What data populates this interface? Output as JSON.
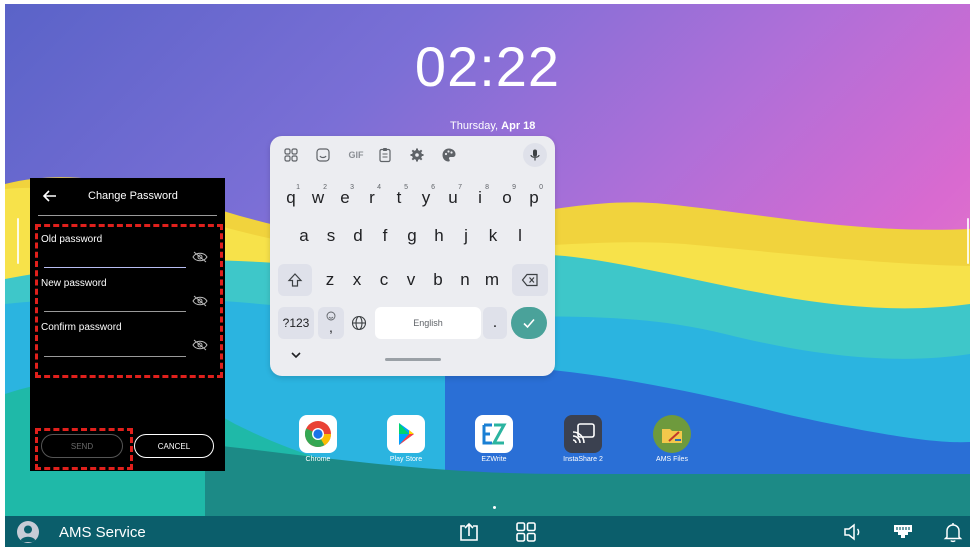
{
  "home": {
    "clock": "02:22",
    "date_weekday": "Thursday,",
    "date_day": "Apr 18"
  },
  "change_password": {
    "title": "Change Password",
    "fields": [
      {
        "label": "Old password",
        "value": ""
      },
      {
        "label": "New password",
        "value": ""
      },
      {
        "label": "Confirm password",
        "value": ""
      }
    ],
    "send_label": "SEND",
    "cancel_label": "CANCEL"
  },
  "keyboard": {
    "toolbar_icons": [
      "apps-grid-icon",
      "sticker-icon",
      "gif-icon",
      "clipboard-icon",
      "settings-icon",
      "theme-palette-icon",
      "microphone-icon"
    ],
    "gif_label": "GIF",
    "row1": [
      {
        "key": "q",
        "hint": "1"
      },
      {
        "key": "w",
        "hint": "2"
      },
      {
        "key": "e",
        "hint": "3"
      },
      {
        "key": "r",
        "hint": "4"
      },
      {
        "key": "t",
        "hint": "5"
      },
      {
        "key": "y",
        "hint": "6"
      },
      {
        "key": "u",
        "hint": "7"
      },
      {
        "key": "i",
        "hint": "8"
      },
      {
        "key": "o",
        "hint": "9"
      },
      {
        "key": "p",
        "hint": "0"
      }
    ],
    "row2": [
      "a",
      "s",
      "d",
      "f",
      "g",
      "h",
      "j",
      "k",
      "l"
    ],
    "row3": [
      "z",
      "x",
      "c",
      "v",
      "b",
      "n",
      "m"
    ],
    "symbols_label": "?123",
    "comma_label": ",",
    "space_label": "English",
    "period_label": "."
  },
  "apps": [
    {
      "label": "Chrome",
      "icon": "chrome-icon"
    },
    {
      "label": "Play Store",
      "icon": "play-store-icon"
    },
    {
      "label": "EZWrite",
      "icon": "ezwrite-icon"
    },
    {
      "label": "InstaShare 2",
      "icon": "instashare-icon"
    },
    {
      "label": "AMS Files",
      "icon": "ams-files-icon"
    }
  ],
  "taskbar": {
    "user_name": "AMS Service",
    "icons": [
      "avatar-icon",
      "share-screen-icon",
      "app-drawer-icon",
      "volume-icon",
      "network-icon",
      "notification-bell-icon"
    ]
  },
  "colors": {
    "accent_enter": "#4aa29a",
    "annotation_red": "#e0201c",
    "taskbar": "#0b5e6b"
  }
}
